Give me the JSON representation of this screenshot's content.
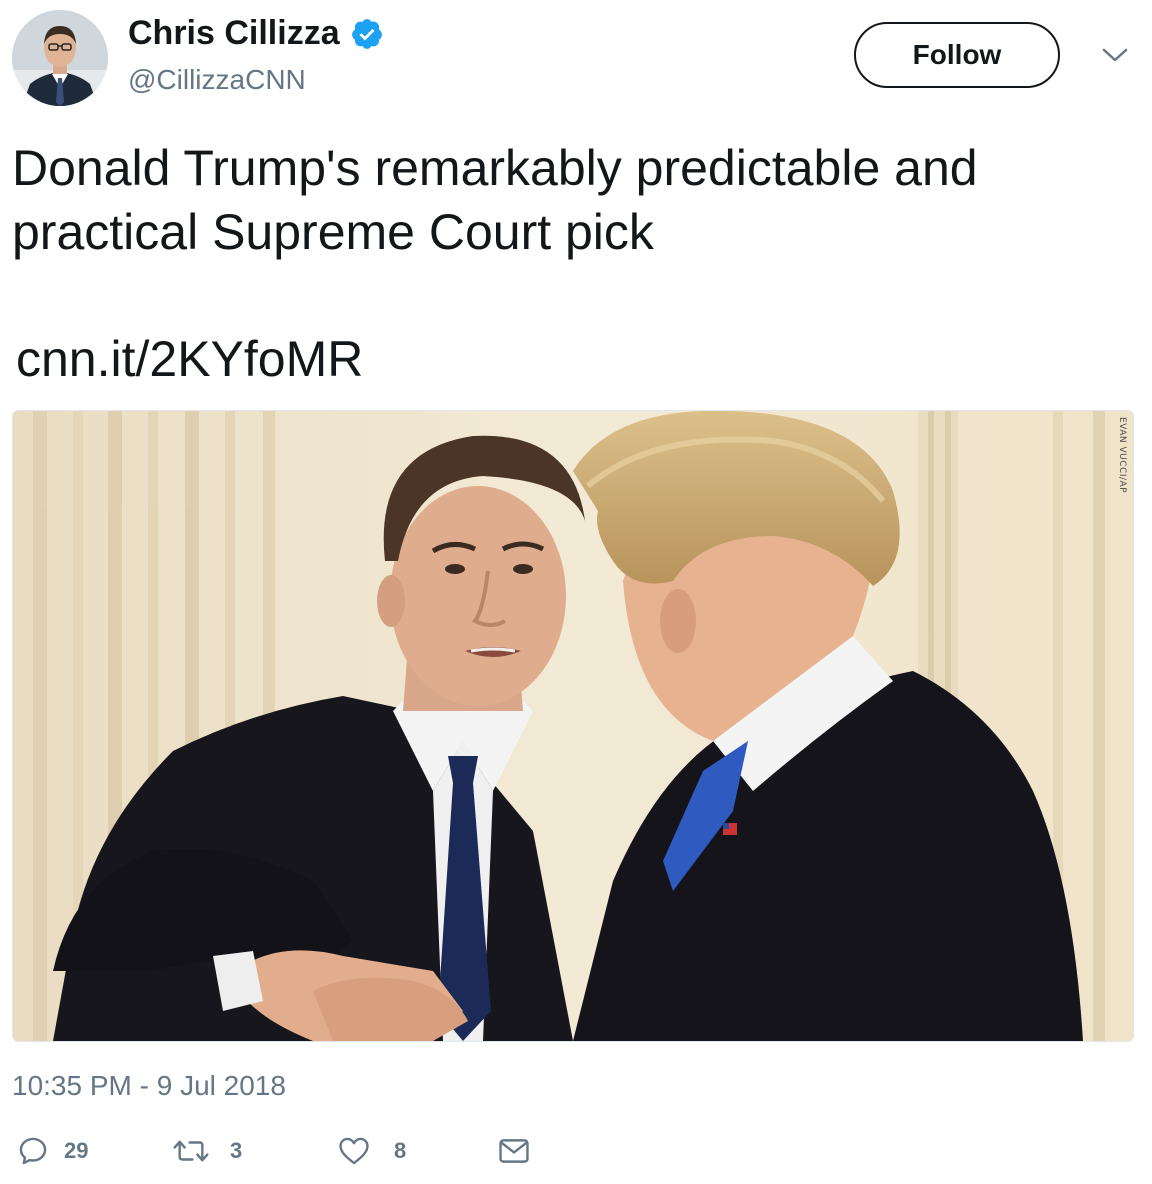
{
  "author": {
    "name": "Chris Cillizza",
    "handle": "@CillizzaCNN",
    "verified": true
  },
  "follow_label": "Follow",
  "tweet": {
    "text": "Donald Trump's remarkably predictable and practical Supreme Court pick",
    "link": "cnn.it/2KYfoMR",
    "photo_credit": "EVAN VUCCI/AP",
    "timestamp": "10:35 PM - 9 Jul 2018"
  },
  "actions": {
    "replies": "29",
    "retweets": "3",
    "likes": "8"
  },
  "icons": {
    "verified": "verified-badge-icon",
    "caret": "chevron-down-icon",
    "reply": "reply-icon",
    "retweet": "retweet-icon",
    "like": "heart-icon",
    "message": "envelope-icon"
  },
  "colors": {
    "text": "#14171a",
    "secondary": "#657786",
    "verified": "#1da1f2"
  }
}
